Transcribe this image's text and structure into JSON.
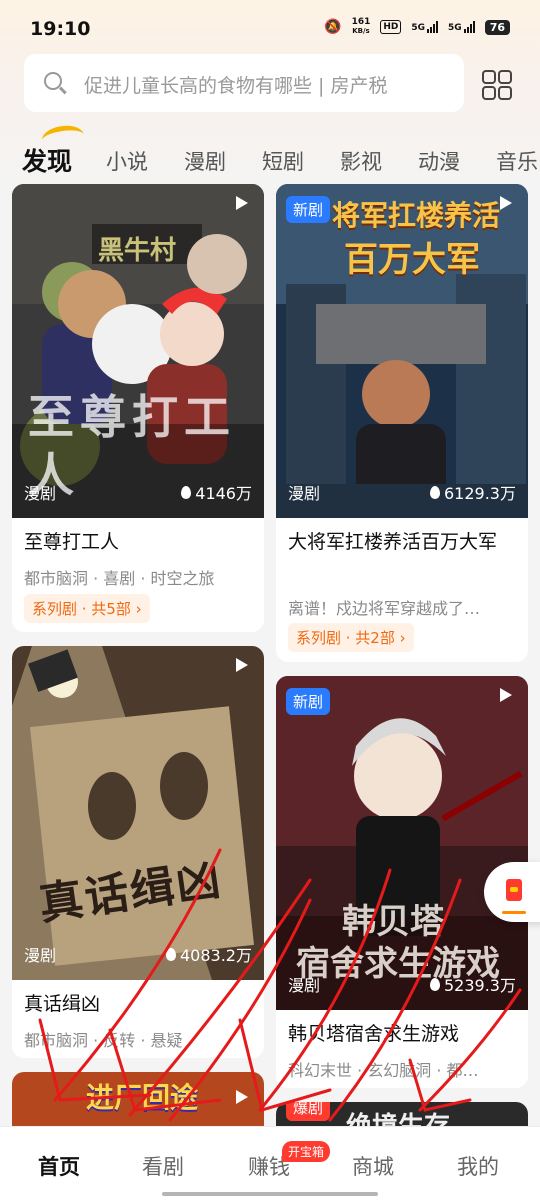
{
  "status_bar": {
    "time": "19:10",
    "net_speed_value": "161",
    "net_speed_unit": "KB/s",
    "hd_label": "HD",
    "signal1_label": "5G",
    "signal2_label": "5G",
    "battery": "76"
  },
  "search": {
    "placeholder": "促进儿童长高的食物有哪些 | 房产税"
  },
  "tabs": [
    "发现",
    "小说",
    "漫剧",
    "短剧",
    "影视",
    "动漫",
    "音乐"
  ],
  "cards": [
    {
      "thumb_title": "至尊打工人",
      "thumb_sign": "黑牛村",
      "type_label": "漫剧",
      "views": "4146万",
      "title": "至尊打工人",
      "subtitle": "都市脑洞 · 喜剧 · 时空之旅",
      "series": "系列剧 · 共5部 ›"
    },
    {
      "badge": "新剧",
      "thumb_title_line1": "将军扛楼养活",
      "thumb_title_line2": "百万大军",
      "type_label": "漫剧",
      "views": "6129.3万",
      "title": "大将军扛楼养活百万大军",
      "subtitle": "离谱！戍边将军穿越成了…",
      "series": "系列剧 · 共2部 ›"
    },
    {
      "thumb_title": "真话缉凶",
      "type_label": "漫剧",
      "views": "4083.2万",
      "title": "真话缉凶",
      "subtitle": "都市脑洞 · 反转 · 悬疑"
    },
    {
      "badge": "新剧",
      "thumb_title_line1": "韩贝塔",
      "thumb_title_line2": "宿舍求生游戏",
      "type_label": "漫剧",
      "views": "5239.3万",
      "title": "韩贝塔宿舍求生游戏",
      "subtitle": "科幻末世 · 玄幻脑洞 · 都…"
    },
    {
      "thumb_title": "进厂回途"
    },
    {
      "badge": "爆剧",
      "thumb_title": "绝境生存"
    }
  ],
  "bottom_nav": {
    "items": [
      "首页",
      "看剧",
      "赚钱",
      "商城",
      "我的"
    ],
    "badge": "开宝箱",
    "active": "首页"
  },
  "colors": {
    "accent_orange": "#f06a13",
    "badge_blue": "#2b7bff",
    "badge_red": "#ff3b30",
    "annotation_red": "#e51a1a"
  }
}
